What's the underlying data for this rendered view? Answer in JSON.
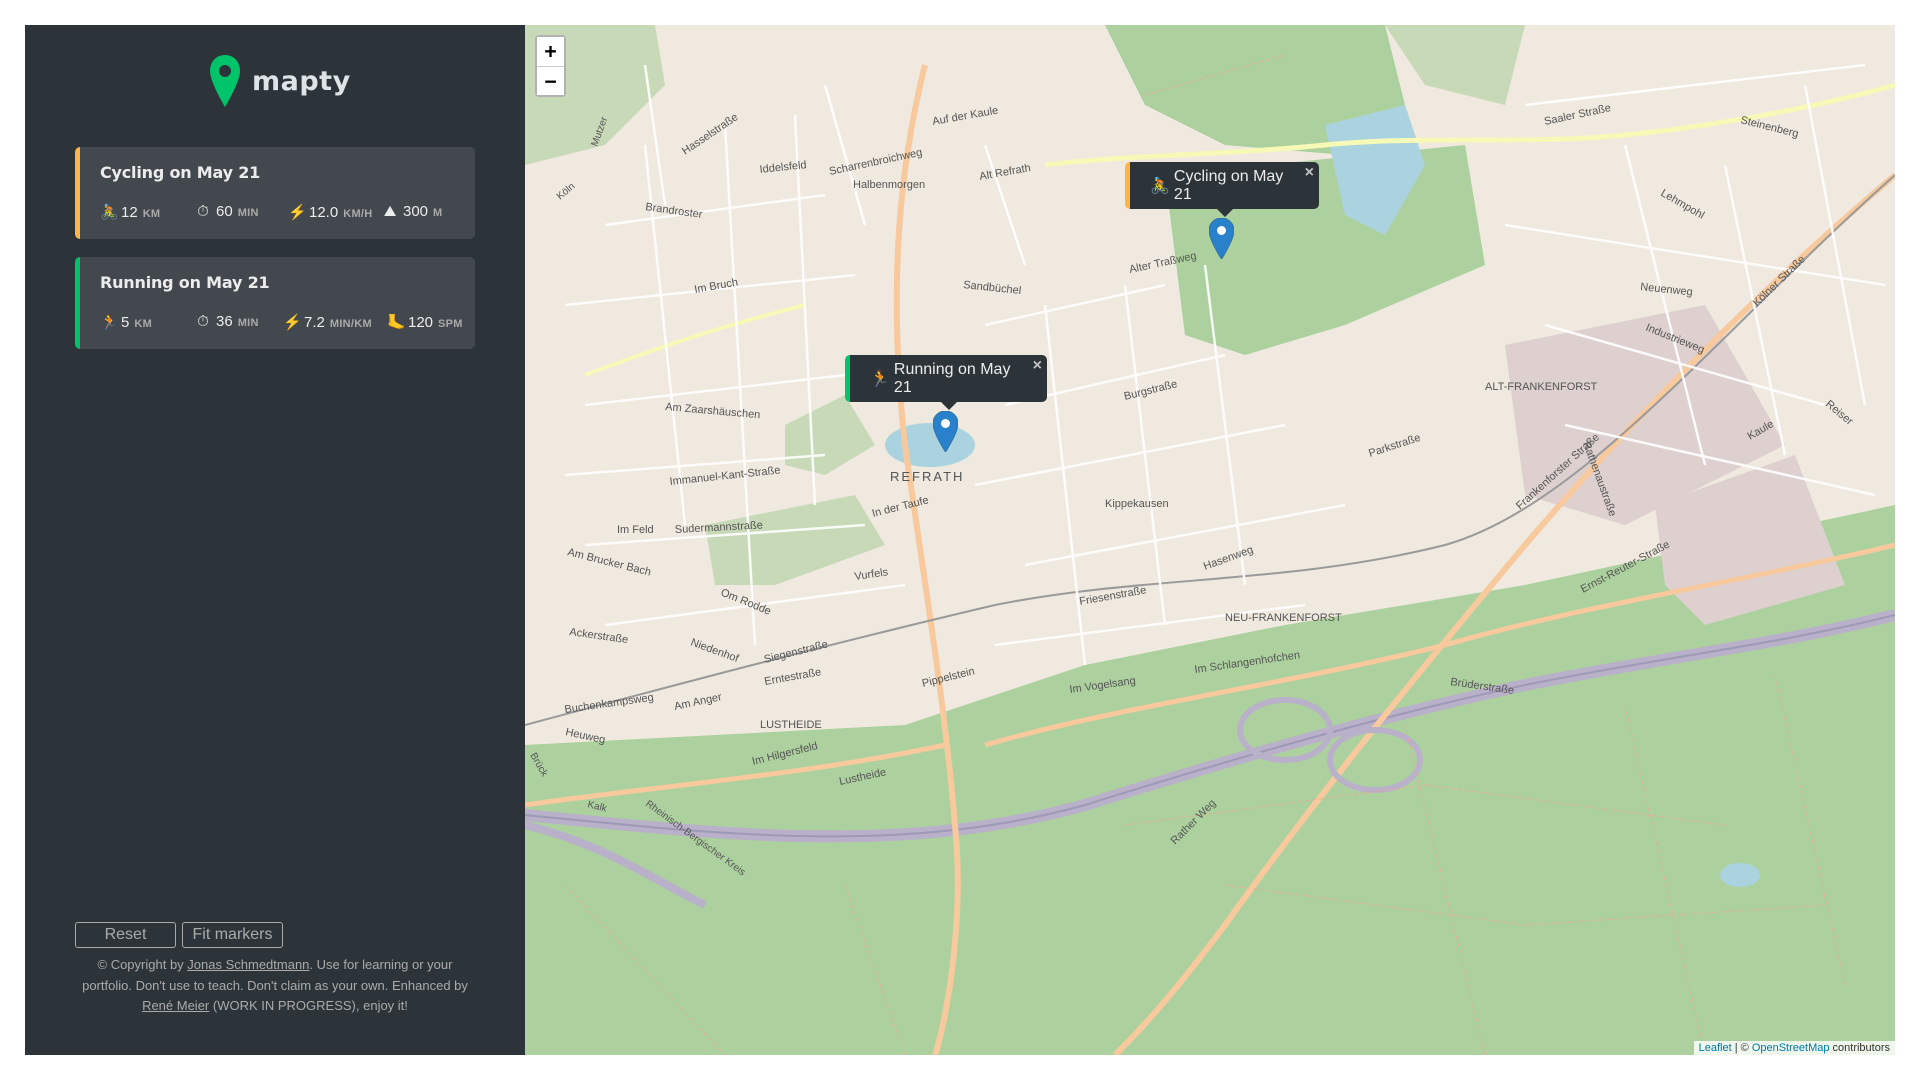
{
  "app": {
    "name": "mapty"
  },
  "workouts": [
    {
      "title": "Cycling on May 21",
      "type": "cycling",
      "color": "#ffb545",
      "details": [
        {
          "icon": "cycling-icon",
          "glyph": "🚴",
          "value": "12",
          "unit": "km"
        },
        {
          "icon": "stopwatch-icon",
          "glyph": "⏱",
          "value": "60",
          "unit": "min"
        },
        {
          "icon": "lightning-icon",
          "glyph": "⚡",
          "value": "12.0",
          "unit": "km/h"
        },
        {
          "icon": "mountain-icon",
          "glyph": "⛰",
          "value": "300",
          "unit": "m"
        }
      ]
    },
    {
      "title": "Running on May 21",
      "type": "running",
      "color": "#00c46a",
      "details": [
        {
          "icon": "running-icon",
          "glyph": "🏃",
          "value": "5",
          "unit": "km"
        },
        {
          "icon": "stopwatch-icon",
          "glyph": "⏱",
          "value": "36",
          "unit": "min"
        },
        {
          "icon": "lightning-icon",
          "glyph": "⚡",
          "value": "7.2",
          "unit": "min/km"
        },
        {
          "icon": "footprint-icon",
          "glyph": "🦶",
          "value": "120",
          "unit": "spm"
        }
      ]
    }
  ],
  "buttons": {
    "reset": "Reset",
    "fit": "Fit markers"
  },
  "copyright": {
    "prefix": "© Copyright by ",
    "author": "Jonas Schmedtmann",
    "middle": ". Use for learning or your portfolio. Don't use to teach. Don't claim as your own.",
    "enhanced_prefix": "Enhanced by ",
    "enhancer": "René Meier",
    "suffix": " (WORK IN PROGRESS), enjoy it!"
  },
  "map": {
    "zoom_in": "+",
    "zoom_out": "−",
    "popups": [
      {
        "label": "Cycling on May 21",
        "glyph": "🚴",
        "close": "×"
      },
      {
        "label": "Running on May 21",
        "glyph": "🏃",
        "close": "×"
      }
    ],
    "place_labels": [
      "REFRATH",
      "ALT-FRANKENFORST",
      "NEU-FRANKENFORST",
      "LUSTHEIDE",
      "Saaler Straße",
      "Industrieweg",
      "Frankenforster Straße",
      "Brüderstraße",
      "Lustheide",
      "Im Hilgersfeld",
      "Siegenstraße",
      "Vurfels",
      "Kippekausen",
      "Hasenweg",
      "Parkstraße",
      "Alter Traßweg",
      "Sandbüchel",
      "Im Bruch",
      "Am Zaarshäuschen",
      "Immanuel-Kant-Straße",
      "Sudermannstraße",
      "Im Feld",
      "Am Brucker Bach",
      "Ackerstraße",
      "Niedenhof",
      "Buchenkampsweg",
      "Heuweg",
      "Rather Weg",
      "Neuenweg",
      "Im Vogelsang",
      "Im Schlangenhofchen",
      "Am Anger",
      "Erntestraße",
      "Pippelstein",
      "Friesenstraße",
      "Burgstraße",
      "In der Taufe",
      "Om Rodde",
      "Brandroster",
      "Iddelsfeld",
      "Halbenmorgen",
      "Scharrenbroichweg",
      "Hasselstraße",
      "Alt Refrath",
      "Auf der Kaule",
      "Steinenberg",
      "Lehmpohl",
      "Kaule",
      "Reiser",
      "Ernst-Reuter-Straße",
      "Rathenaustraße",
      "Kölner Straße",
      "Mutzer",
      "Köln",
      "Kalk",
      "Brück",
      "Rheinisch-Bergischer Kreis"
    ],
    "attribution_link1": "Leaflet",
    "attribution_sep": " | © ",
    "attribution_link2": "OpenStreetMap",
    "attribution_tail": " contributors"
  },
  "colors": {
    "sidebar_bg": "#2d3439",
    "card_bg": "#42484d",
    "cycling": "#ffb545",
    "running": "#00c46a",
    "marker": "#2a81cb"
  }
}
